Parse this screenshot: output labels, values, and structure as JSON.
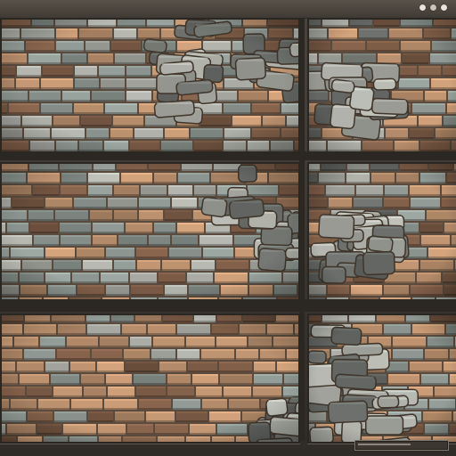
{
  "window": {
    "controls": [
      "minimize-icon",
      "maximize-icon",
      "close-icon"
    ]
  },
  "panels": [
    {
      "name": "texture-panel-top-wide",
      "variant": "gray-top"
    },
    {
      "name": "texture-panel-top-right",
      "variant": "mixed-right"
    },
    {
      "name": "texture-panel-middle-wide",
      "variant": "gray-band"
    },
    {
      "name": "texture-panel-middle-right",
      "variant": "mixed-right"
    },
    {
      "name": "texture-panel-bottom-wide",
      "variant": "tan"
    },
    {
      "name": "texture-panel-bottom-right",
      "variant": "mixed-right"
    }
  ],
  "status": {
    "progress": 0.6
  },
  "colors": {
    "brick_tan": "#b98f6d",
    "brick_dark": "#7a5a45",
    "brick_gray": "#8b948f",
    "stone_gray": "#a7a9a2",
    "stone_dark": "#676a66",
    "mortar": "#5a4b3e",
    "frame_bg": "#3a352f"
  }
}
